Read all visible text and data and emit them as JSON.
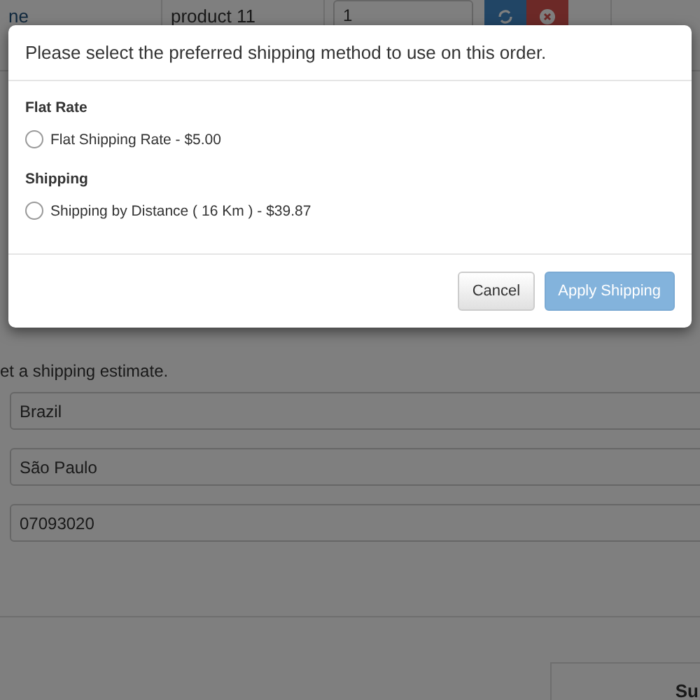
{
  "cart_row": {
    "column_1": "ne",
    "product": "product 11",
    "quantity": "1"
  },
  "estimate": {
    "text": "et a shipping estimate.",
    "fields": [
      {
        "value": "Brazil"
      },
      {
        "value": "São Paulo"
      },
      {
        "value": "07093020"
      }
    ]
  },
  "totals": {
    "label": "Su"
  },
  "modal": {
    "title": "Please select the preferred shipping method to use on this order.",
    "groups": [
      {
        "heading": "Flat Rate",
        "options": [
          {
            "label": "Flat Shipping Rate - $5.00",
            "selected": false
          }
        ]
      },
      {
        "heading": "Shipping",
        "options": [
          {
            "label": "Shipping by Distance ( 16 Km ) - $39.87",
            "selected": false
          }
        ]
      }
    ],
    "buttons": [
      {
        "label": "Cancel",
        "kind": "default",
        "disabled": false
      },
      {
        "label": "Apply Shipping",
        "kind": "primary",
        "disabled": true
      }
    ]
  }
}
